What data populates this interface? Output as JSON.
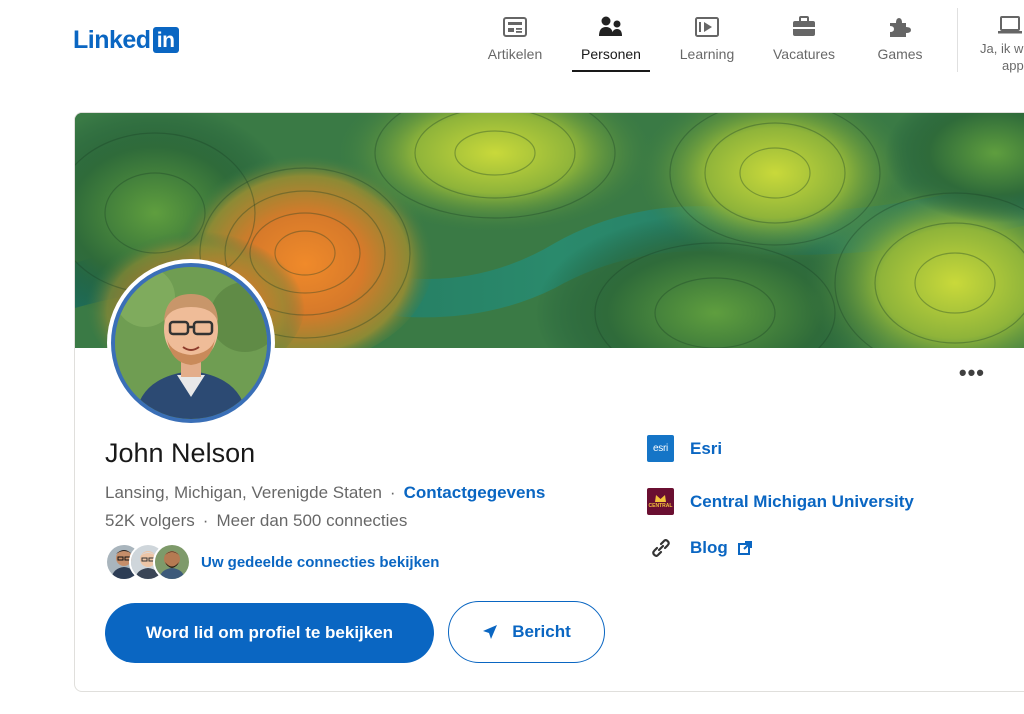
{
  "header": {
    "logo_word": "Linked",
    "logo_box": "in",
    "nav": [
      {
        "label": "Artikelen",
        "icon": "articles-icon"
      },
      {
        "label": "Personen",
        "icon": "people-icon",
        "active": true
      },
      {
        "label": "Learning",
        "icon": "learning-icon"
      },
      {
        "label": "Vacatures",
        "icon": "briefcase-icon"
      },
      {
        "label": "Games",
        "icon": "puzzle-icon"
      }
    ],
    "app_line1": "Ja, ik w",
    "app_line2": "app"
  },
  "profile": {
    "name": "John Nelson",
    "location": "Lansing, Michigan, Verenigde Staten",
    "separator": "·",
    "contact_link": "Contactgegevens",
    "followers": "52K volgers",
    "connections": "Meer dan 500 connecties",
    "mutual_link": "Uw gedeelde connecties bekijken",
    "more_menu": "•••"
  },
  "actions": {
    "join_label": "Word lid om profiel te bekijken",
    "message_label": "Bericht"
  },
  "sidebar": {
    "company": "Esri",
    "company_logo_text": "esri",
    "school": "Central Michigan University",
    "school_logo_text": "CENTRAL",
    "blog": "Blog"
  },
  "colors": {
    "brand": "#0a66c2",
    "avatar_ring": "#3a6fb7",
    "esri_blue": "#1575c7",
    "cmu_maroon": "#6a0f31"
  }
}
